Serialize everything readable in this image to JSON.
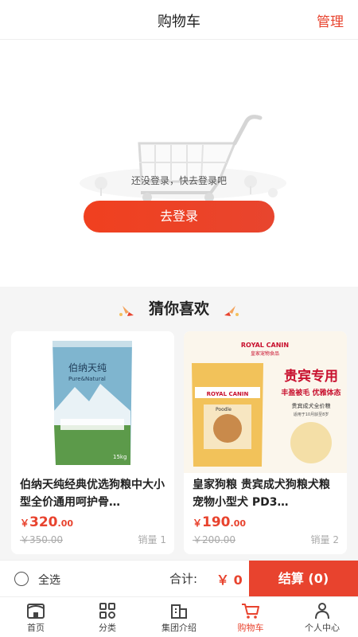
{
  "header": {
    "title": "购物车",
    "manage": "管理"
  },
  "empty_cart": {
    "message": "还没登录，快去登录吧",
    "login_button": "去登录"
  },
  "recommend": {
    "title": "猜你喜欢",
    "products": [
      {
        "name": "伯纳天纯经典优选狗粮中大小型全价通用呵护骨…",
        "price_symbol": "￥",
        "price_int": "320",
        "price_dec": ".00",
        "old_price": "￥350.00",
        "sales": "销量 1",
        "package_brand": "伯纳天纯",
        "package_sub": "Pure&Natural",
        "package_weight": "15kg"
      },
      {
        "name": "皇家狗粮 贵宾成犬狗粮犬粮 宠物小型犬 PD3…",
        "price_symbol": "￥",
        "price_int": "190",
        "price_dec": ".00",
        "old_price": "￥200.00",
        "sales": "销量 2",
        "banner_brand": "ROYAL CANIN",
        "banner_brand_cn": "皇家宠物食品",
        "banner_headline": "贵宾专用",
        "banner_tagline": "丰盈被毛 优雅体态",
        "banner_desc1": "贵宾成犬全价粮",
        "banner_desc2": "适用于10月龄至8岁",
        "package_label": "Poodle"
      }
    ]
  },
  "checkout": {
    "select_all": "全选",
    "total_label": "合计:",
    "total_value": "￥ 0",
    "button": "结算 (0)"
  },
  "tabs": [
    {
      "label": "首页",
      "icon": "home-icon"
    },
    {
      "label": "分类",
      "icon": "category-icon"
    },
    {
      "label": "集团介绍",
      "icon": "building-icon"
    },
    {
      "label": "购物车",
      "icon": "cart-icon"
    },
    {
      "label": "个人中心",
      "icon": "user-icon"
    }
  ],
  "colors": {
    "accent": "#e8432e",
    "background": "#f5f5f5"
  }
}
